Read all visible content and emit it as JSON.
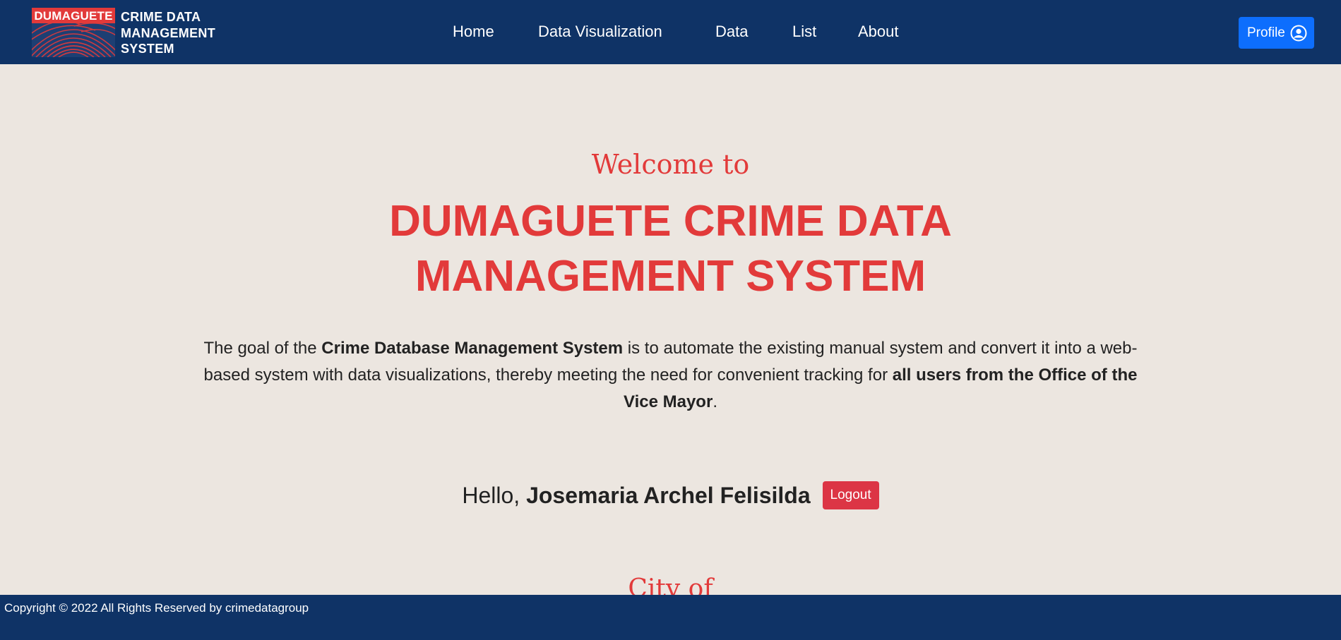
{
  "navbar": {
    "logo": {
      "badge_text": "DUMAGUETE",
      "title_lines": [
        "CRIME DATA",
        "MANAGEMENT",
        "SYSTEM"
      ],
      "art_icon": "fingerprint-icon"
    },
    "links": [
      {
        "label": "Home"
      },
      {
        "label": "Data Visualization"
      },
      {
        "label": "Data"
      },
      {
        "label": "List"
      },
      {
        "label": "About"
      }
    ],
    "profile_button": {
      "label": "Profile",
      "icon": "user-circle-icon"
    }
  },
  "hero": {
    "welcome": "Welcome to",
    "title_line1": "DUMAGUETE CRIME DATA",
    "title_line2": "MANAGEMENT SYSTEM",
    "goal": {
      "part1": "The goal of the ",
      "bold1": "Crime Database Management System",
      "part2": " is to automate the existing manual system and convert it into a web-based system with data visualizations, thereby meeting the need for convenient tracking for ",
      "bold2": "all users from the Office of the Vice Mayor",
      "part3": "."
    },
    "greeting": "Hello, ",
    "user_name": "Josemaria Archel Felisilda",
    "logout_label": "Logout",
    "city_heading": "City of"
  },
  "footer": {
    "text": "Copyright © 2022 All Rights Reserved by crimedatagroup"
  },
  "colors": {
    "navbar_bg": "#0f3366",
    "page_bg": "#ece6e0",
    "accent_red": "#e23a3a",
    "profile_blue": "#0d6efd",
    "logout_red": "#dc3545"
  }
}
